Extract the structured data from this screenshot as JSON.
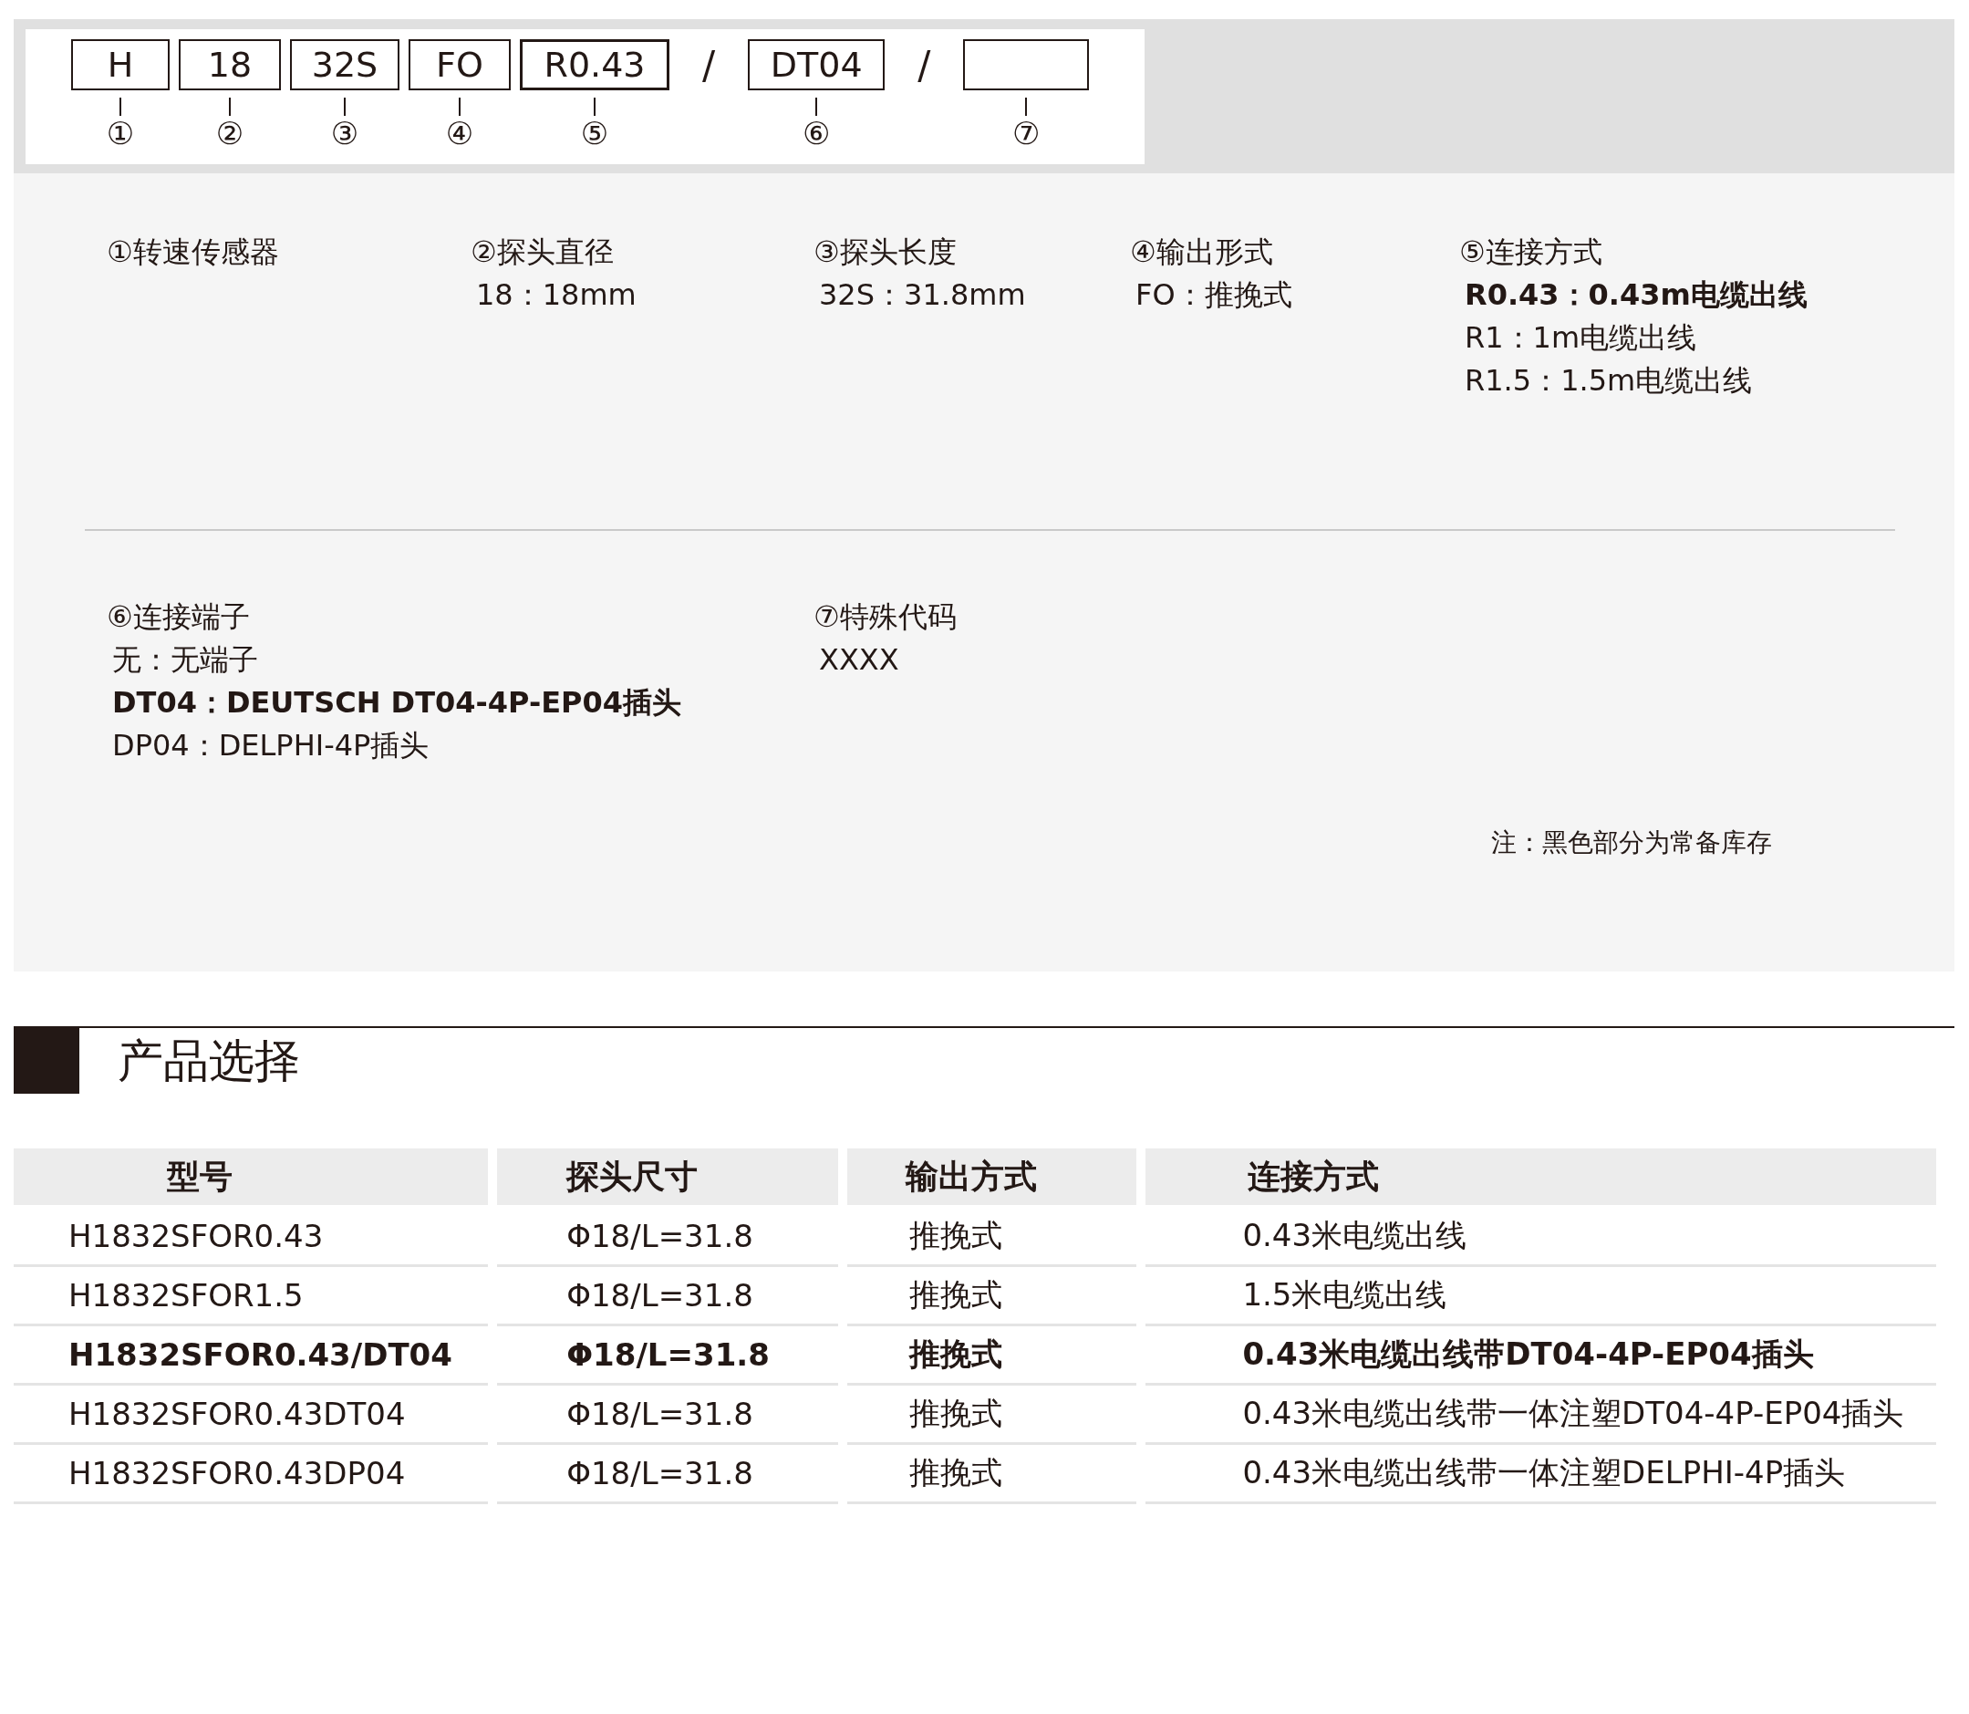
{
  "code_parts": [
    {
      "kind": "box",
      "code": "H",
      "number": "①"
    },
    {
      "kind": "box",
      "code": "18",
      "number": "②"
    },
    {
      "kind": "box",
      "code": "32S",
      "number": "③"
    },
    {
      "kind": "box",
      "code": "FO",
      "number": "④"
    },
    {
      "kind": "box",
      "code": "R0.43",
      "number": "⑤"
    },
    {
      "kind": "slash",
      "code": "/"
    },
    {
      "kind": "box",
      "code": "DT04",
      "number": "⑥"
    },
    {
      "kind": "slash",
      "code": "/"
    },
    {
      "kind": "box",
      "number": "⑦"
    }
  ],
  "option_groups": [
    {
      "items": [
        {
          "heading": "①转速传感器"
        },
        {
          "heading": "②探头直径",
          "options": [
            {
              "text": "18：18mm",
              "bold": false
            }
          ]
        },
        {
          "heading": "③探头长度",
          "options": [
            {
              "text": "32S：31.8mm",
              "bold": false
            }
          ]
        },
        {
          "heading": "④输出形式",
          "options": [
            {
              "text": "FO：推挽式",
              "bold": false
            }
          ]
        },
        {
          "heading": "⑤连接方式",
          "options": [
            {
              "text": "R0.43：0.43m电缆出线",
              "bold": true
            },
            {
              "text": "R1：1m电缆出线",
              "bold": false
            },
            {
              "text": "R1.5：1.5m电缆出线",
              "bold": false
            }
          ]
        }
      ]
    },
    {
      "items": [
        {
          "heading": "⑥连接端子",
          "options": [
            {
              "text": "无：无端子",
              "bold": false
            },
            {
              "text": "DT04：DEUTSCH DT04-4P-EP04插头",
              "bold": true
            },
            {
              "text": "DP04：DELPHI-4P插头",
              "bold": false
            }
          ]
        },
        {
          "heading": "⑦特殊代码",
          "options": [
            {
              "text": "XXXX",
              "bold": false
            }
          ]
        }
      ]
    }
  ],
  "note": "注：黑色部分为常备库存",
  "section_title": "产品选择",
  "table": {
    "columns": [
      "型号",
      "探头尺寸",
      "输出方式",
      "连接方式"
    ],
    "rows": [
      {
        "cells": [
          "H1832SFOR0.43",
          "Φ18/L=31.8",
          "推挽式",
          "0.43米电缆出线"
        ],
        "bold": false
      },
      {
        "cells": [
          "H1832SFOR1.5",
          "Φ18/L=31.8",
          "推挽式",
          "1.5米电缆出线"
        ],
        "bold": false
      },
      {
        "cells": [
          "H1832SFOR0.43/DT04",
          "Φ18/L=31.8",
          "推挽式",
          "0.43米电缆出线带DT04-4P-EP04插头"
        ],
        "bold": true
      },
      {
        "cells": [
          "H1832SFOR0.43DT04",
          "Φ18/L=31.8",
          "推挽式",
          "0.43米电缆出线带一体注塑DT04-4P-EP04插头"
        ],
        "bold": false
      },
      {
        "cells": [
          "H1832SFOR0.43DP04",
          "Φ18/L=31.8",
          "推挽式",
          "0.43米电缆出线带一体注塑DELPHI-4P插头"
        ],
        "bold": false
      }
    ]
  }
}
